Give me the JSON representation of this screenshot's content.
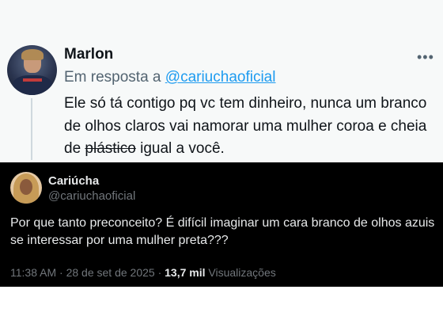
{
  "reply_tweet": {
    "author_name": "Marlon",
    "reply_prefix": "Em resposta a ",
    "reply_mention": "@cariuchaoficial",
    "more_icon": "more-horizontal-icon",
    "body_before": "Ele só tá contigo pq vc tem dinheiro, nunca um branco de olhos claros vai namorar uma mulher coroa e cheia de ",
    "body_struck": "plástico",
    "body_after": " igual a você."
  },
  "main_tweet": {
    "author_name": "Cariúcha",
    "author_handle": "@cariuchaoficial",
    "text": "Por que tanto preconceito? É difícil imaginar um cara branco de olhos azuis se interessar por uma mulher preta???",
    "time": "11:38 AM",
    "separator": "·",
    "date": "28 de set de 2025",
    "views_count": "13,7 mil",
    "views_label": "Visualizações"
  },
  "colors": {
    "link": "#1d9bf0",
    "dark_bg": "#000000",
    "light_bg": "#f7f9f9",
    "muted": "#71767b"
  }
}
